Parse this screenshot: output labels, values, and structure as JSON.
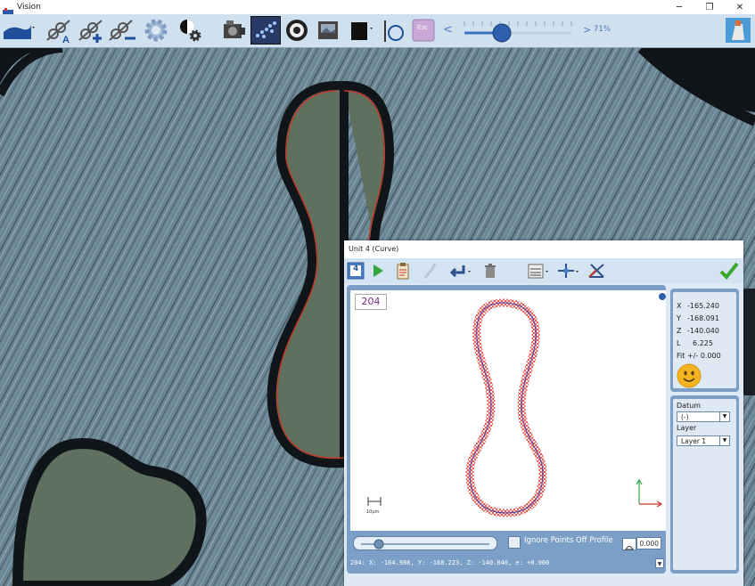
{
  "window": {
    "title": "Vision",
    "controls": [
      "minimize-icon",
      "restore-icon",
      "close-icon"
    ]
  },
  "toolbar": {
    "zoom_value": "71%",
    "zoom_slider_level": 0.35,
    "prev_symbol": "<",
    "next_symbol": ">",
    "buttons": [
      "profile-icon",
      "measure-a-icon",
      "add-feature-icon",
      "remove-feature-icon",
      "settings-gear-icon",
      "light-gear-icon",
      "camera-icon",
      "scatter-points-icon",
      "ring-icon",
      "folder-image-icon",
      "lamp-icon",
      "probe-circle-icon",
      "esc-key-icon",
      "app-avatar-icon"
    ],
    "esc_label": "Esc"
  },
  "dialog": {
    "title": "Unit 4 (Curve)",
    "toolbar_tab": "4",
    "point_count": "204",
    "scale_label": "10µm",
    "ignore_label": "Ignore Points Off Profile",
    "tolerance_value": "0.000",
    "status_line": "204: X: -164.986,  Y: -168.223,  Z: -140.040,  e: +0.000",
    "readout": {
      "x_label": "X",
      "x_value": "-165.240",
      "y_label": "Y",
      "y_value": "-168.091",
      "z_label": "Z",
      "z_value": "-140.040",
      "l_label": "L",
      "l_value": "6.225",
      "fit_label": "Fit",
      "fit_value": "+/- 0.000"
    },
    "datum_label": "Datum",
    "datum_value": "(-)",
    "layer_label": "Layer",
    "layer_value": "Layer 1"
  },
  "colors": {
    "accent": "#4b7bc2",
    "panel": "#7b9fc7",
    "profile_red": "#d0302a",
    "check_green": "#3aa82e"
  }
}
